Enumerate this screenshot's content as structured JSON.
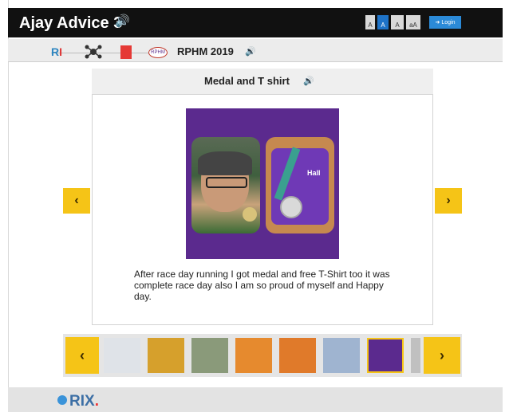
{
  "app": {
    "title": "Ajay Advice 3",
    "speaker_icon": "speaker-icon"
  },
  "header": {
    "font_buttons": [
      "A",
      "A",
      "A",
      "aA"
    ],
    "login_label": "Login",
    "login_icon": "login-icon"
  },
  "breadcrumb": {
    "logo_text_a": "R",
    "logo_text_b": "I",
    "round_badge": "RPHM",
    "title": "RPHM 2019",
    "icons": [
      "ri-logo-icon",
      "network-icon",
      "red-tag-icon",
      "rphm-badge-icon"
    ]
  },
  "card": {
    "title": "Medal and T shirt",
    "image_text": "Hall",
    "caption": "After race day running I got medal and free T-Shirt too it was complete race day also I am so proud of myself and Happy day."
  },
  "nav": {
    "prev": "‹",
    "next": "›"
  },
  "thumbnails": {
    "count": 8,
    "selected_index": 6,
    "colors": [
      "#dfe3e8",
      "#d6a02c",
      "#8a9a7a",
      "#e68a2e",
      "#e07a2a",
      "#9fb4d0",
      "#5b2a8e",
      "#c0c0c0"
    ]
  },
  "footer": {
    "logo_a": "RI",
    "logo_b": "X",
    "logo_dot": "."
  },
  "colors": {
    "accent_yellow": "#f5c417",
    "topbar": "#111111",
    "login_blue": "#2b8ad8"
  }
}
